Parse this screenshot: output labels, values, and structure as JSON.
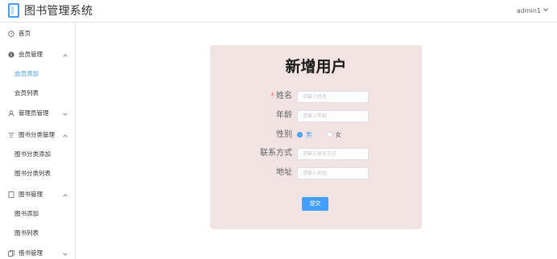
{
  "header": {
    "app_title": "图书管理系统",
    "user_name": "admin1"
  },
  "sidebar": {
    "items": [
      {
        "label": "首页",
        "icon": "clock-icon"
      },
      {
        "label": "会员管理",
        "icon": "info-circle-icon"
      },
      {
        "label": "会员添加"
      },
      {
        "label": "会员列表"
      },
      {
        "label": "管理员管理",
        "icon": "user-icon"
      },
      {
        "label": "图书分类管理",
        "icon": "filter-icon"
      },
      {
        "label": "图书分类添加"
      },
      {
        "label": "图书分类列表"
      },
      {
        "label": "图书管理",
        "icon": "book-icon"
      },
      {
        "label": "图书添加"
      },
      {
        "label": "图书列表"
      },
      {
        "label": "借书管理",
        "icon": "copy-icon"
      }
    ],
    "active_item": "会员添加"
  },
  "form": {
    "title": "新增用户",
    "name_label": "姓名",
    "name_placeholder": "请输入姓名",
    "age_label": "年龄",
    "age_placeholder": "请输入年龄",
    "gender_label": "性别",
    "gender_options": [
      "男",
      "女"
    ],
    "gender_selected": "男",
    "contact_label": "联系方式",
    "contact_placeholder": "请输入联系方式",
    "address_label": "地址",
    "address_placeholder": "请输入地址",
    "submit_label": "提交"
  },
  "colors": {
    "accent": "#409eff",
    "card_background": "#f2e3e3",
    "required_mark": "#f56c6c"
  }
}
